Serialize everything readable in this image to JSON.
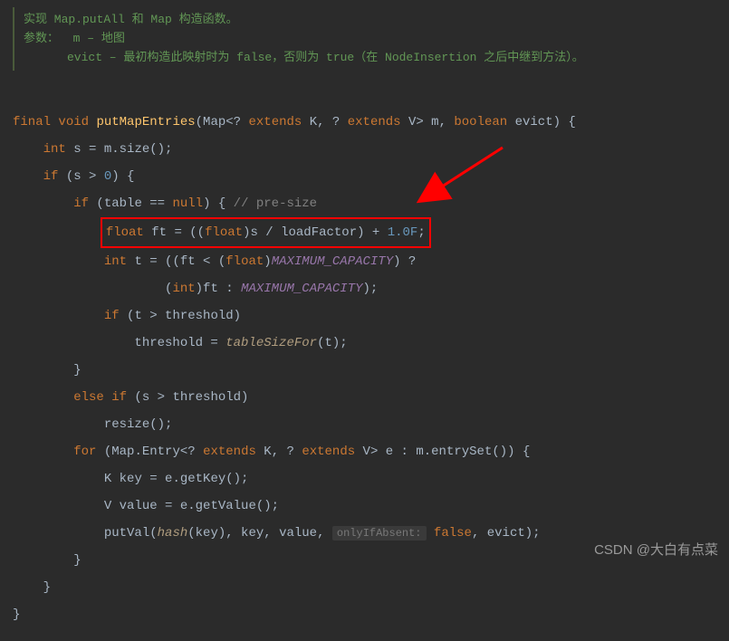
{
  "doc": {
    "line1": "实现 Map.putAll 和 Map 构造函数。",
    "line2_label": "参数：",
    "line2_param": "m – 地图",
    "line3": "evict – 最初构造此映射时为 false，否则为 true（在 NodeInsertion 之后中继到方法）。"
  },
  "code": {
    "kw_final": "final",
    "kw_void": "void",
    "method_name": "putMapEntries",
    "sig_open": "(Map<?",
    "kw_extends1": "extends",
    "type_K": "K",
    "sig_comma": ", ?",
    "kw_extends2": "extends",
    "type_V": "V",
    "sig_close_m": "> m,",
    "kw_boolean": "boolean",
    "param_evict": "evict) {",
    "kw_int1": "int",
    "l_s_assign": " s = m.size();",
    "kw_if1": "if",
    "l_if1_cond": " (s > ",
    "num_0": "0",
    "l_if1_close": ") {",
    "kw_if2": "if",
    "l_if2_cond": " (table == ",
    "kw_null": "null",
    "l_if2_close": ") { ",
    "comment_presize": "// pre-size",
    "kw_float": "float",
    "l_ft_1": " ft = ((",
    "kw_float_cast": "float",
    "l_ft_2": ")s / loadFactor) + ",
    "num_1F": "1.0F",
    "l_ft_end": ";",
    "kw_int2": "int",
    "l_t_1": " t = ((ft < (",
    "kw_float_cast2": "float",
    "l_t_2": ")",
    "const_max1": "MAXIMUM_CAPACITY",
    "l_t_3": ") ?",
    "l_t_4": "(",
    "kw_int_cast": "int",
    "l_t_5": ")ft : ",
    "const_max2": "MAXIMUM_CAPACITY",
    "l_t_6": ");",
    "kw_if3": "if",
    "l_if3_cond": " (t > threshold)",
    "l_thresh_assign": "threshold = ",
    "call_tableSizeFor": "tableSizeFor",
    "l_thresh_args": "(t);",
    "l_brace1": "}",
    "kw_else": "else if",
    "l_elseif_cond": " (s > threshold)",
    "l_resize": "resize();",
    "kw_for": "for",
    "l_for_1": " (Map.Entry<?",
    "kw_extends3": "extends",
    "type_K2": "K",
    "l_for_2": ", ?",
    "kw_extends4": "extends",
    "type_V2": "V",
    "l_for_3": "> e : m.entrySet()) {",
    "type_K3": "K",
    "l_key": " key = e.getKey();",
    "type_V3": "V",
    "l_value": " value = e.getValue();",
    "l_putVal_1": "putVal(",
    "call_hash": "hash",
    "l_putVal_2": "(key), key, value, ",
    "hint_onlyIfAbsent": "onlyIfAbsent:",
    "kw_false": "false",
    "l_putVal_3": ", evict);",
    "l_brace2": "}",
    "l_brace3": "}",
    "l_brace4": "}"
  },
  "watermark": "CSDN @大白有点菜"
}
